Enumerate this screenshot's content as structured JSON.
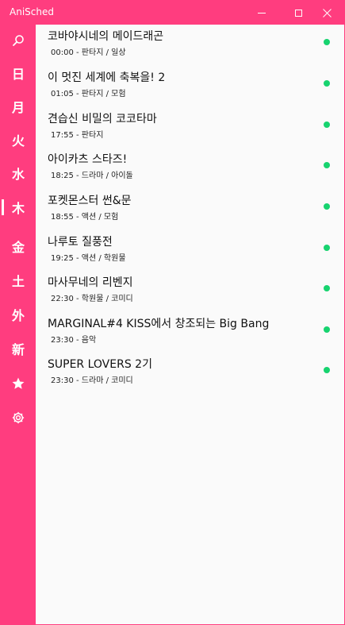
{
  "window": {
    "title": "AniSched",
    "accent": "#ff3d7f",
    "status_color": "#17d36f"
  },
  "sidebar": {
    "items": [
      {
        "id": "search",
        "label": "",
        "icon": "search-icon"
      },
      {
        "id": "sun",
        "label": "日"
      },
      {
        "id": "mon",
        "label": "月"
      },
      {
        "id": "tue",
        "label": "火"
      },
      {
        "id": "wed",
        "label": "水"
      },
      {
        "id": "thu",
        "label": "木",
        "active": true
      },
      {
        "id": "fri",
        "label": "金"
      },
      {
        "id": "sat",
        "label": "土"
      },
      {
        "id": "other",
        "label": "外"
      },
      {
        "id": "new",
        "label": "新"
      },
      {
        "id": "fav",
        "label": "",
        "icon": "star-icon"
      },
      {
        "id": "settings",
        "label": "",
        "icon": "gear-icon"
      }
    ]
  },
  "schedule": [
    {
      "title": "코바야시네의 메이드래곤",
      "time": "00:00",
      "genre": "판타지 / 일상",
      "status": "airing"
    },
    {
      "title": "이 멋진 세계에 축복을! 2",
      "time": "01:05",
      "genre": "판타지 / 모험",
      "status": "airing"
    },
    {
      "title": "견습신 비밀의 코코타마",
      "time": "17:55",
      "genre": "판타지",
      "status": "airing"
    },
    {
      "title": "아이카츠 스타즈!",
      "time": "18:25",
      "genre": "드라마 / 아이돌",
      "status": "airing"
    },
    {
      "title": "포켓몬스터 썬&문",
      "time": "18:55",
      "genre": "액션 / 모험",
      "status": "airing"
    },
    {
      "title": "나루토 질풍전",
      "time": "19:25",
      "genre": "액션 / 학원물",
      "status": "airing"
    },
    {
      "title": "마사무네의 리벤지",
      "time": "22:30",
      "genre": "학원물 / 코미디",
      "status": "airing"
    },
    {
      "title": "MARGINAL#4 KISS에서 창조되는 Big Bang",
      "time": "23:30",
      "genre": "음악",
      "status": "airing"
    },
    {
      "title": "SUPER LOVERS 2기",
      "time": "23:30",
      "genre": "드라마 / 코미디",
      "status": "airing"
    }
  ],
  "separator": " - "
}
